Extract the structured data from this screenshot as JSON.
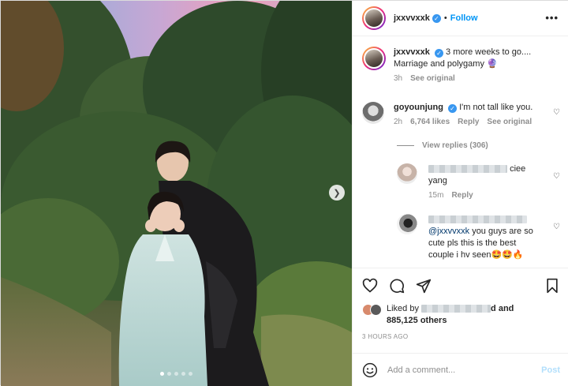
{
  "post": {
    "username": "jxxvvxxk",
    "follow_label": "Follow",
    "separator": "•",
    "more_label": "•••",
    "carousel": {
      "slide_count": 5,
      "active_slide": 1
    }
  },
  "caption": {
    "username": "jxxvvxxk",
    "text_line1": "3 more weeks to go....",
    "text_line2": "Marriage and polygamy",
    "emoji": "🔮",
    "time": "3h",
    "see_original": "See original"
  },
  "comments": [
    {
      "username": "goyounjung",
      "text": "I'm not tall like you.",
      "time": "2h",
      "likes": "6,764 likes",
      "reply": "Reply",
      "see_original": "See original",
      "view_replies": "View replies (306)"
    },
    {
      "text_tail": "ciee",
      "text_line2": "yang",
      "time": "15m",
      "reply": "Reply"
    },
    {
      "mention": "@jxxvvxxk",
      "text": "you guys are so cute pls this is the best couple i hv seen",
      "emoji": "🤩🤩🔥"
    }
  ],
  "likes": {
    "prefix": "Liked by",
    "tail": "d and",
    "count": "885,125 others"
  },
  "time_ago": "3 HOURS AGO",
  "add_comment": {
    "placeholder": "Add a comment...",
    "post_label": "Post"
  },
  "colors": {
    "accent": "#0095f6",
    "verified": "#3897f0",
    "muted": "#8e8e8e",
    "post_disabled": "#b2dffc"
  }
}
